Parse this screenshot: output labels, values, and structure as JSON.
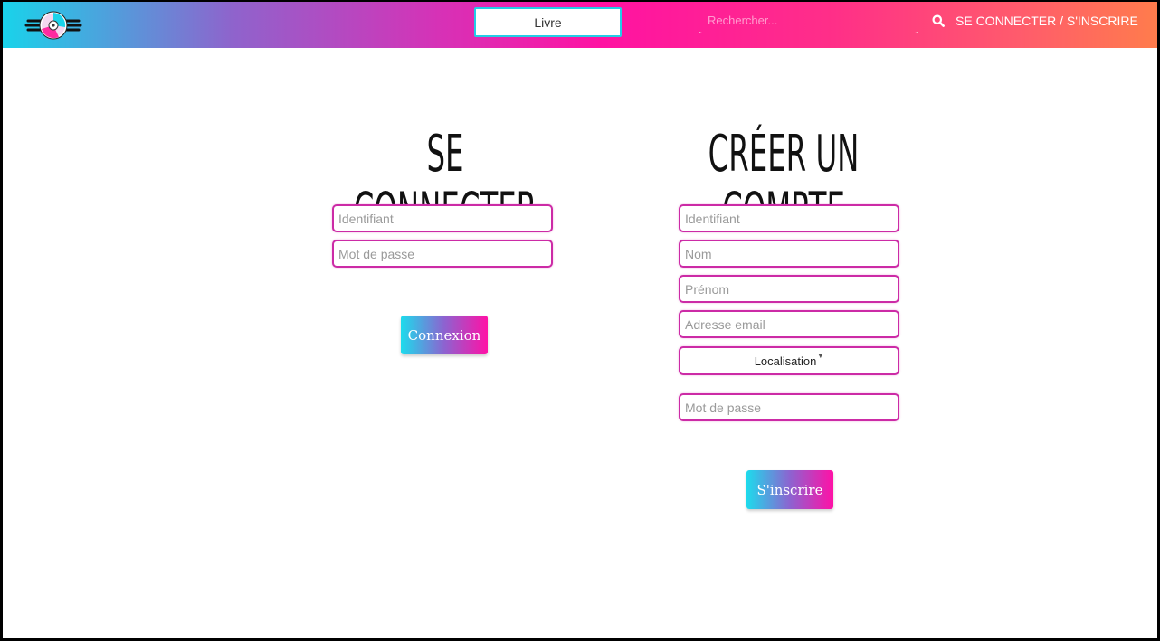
{
  "navbar": {
    "logo_icon": "vinyl-disc-with-wings-logo",
    "category_button": "Livre",
    "search_placeholder": "Rechercher...",
    "search_icon": "magnifier-icon",
    "auth_link": "SE CONNECTER / S'INSCRIRE",
    "gradient_colors": [
      "#19d3ea",
      "#d731b6",
      "#ff12a2",
      "#ff7c4c"
    ]
  },
  "login": {
    "title": "SE CONNECTER",
    "username_placeholder": "Identifiant",
    "password_placeholder": "Mot de passe",
    "submit_label": "Connexion"
  },
  "signup": {
    "title": "CRÉER UN COMPTE",
    "username_placeholder": "Identifiant",
    "lastname_placeholder": "Nom",
    "firstname_placeholder": "Prénom",
    "email_placeholder": "Adresse email",
    "location_label": "Localisation",
    "password_placeholder": "Mot de passe",
    "submit_label": "S'inscrire"
  },
  "colors": {
    "field_border": "#cc2ba6",
    "button_gradient": [
      "#1ddbec",
      "#ff11a6"
    ]
  }
}
